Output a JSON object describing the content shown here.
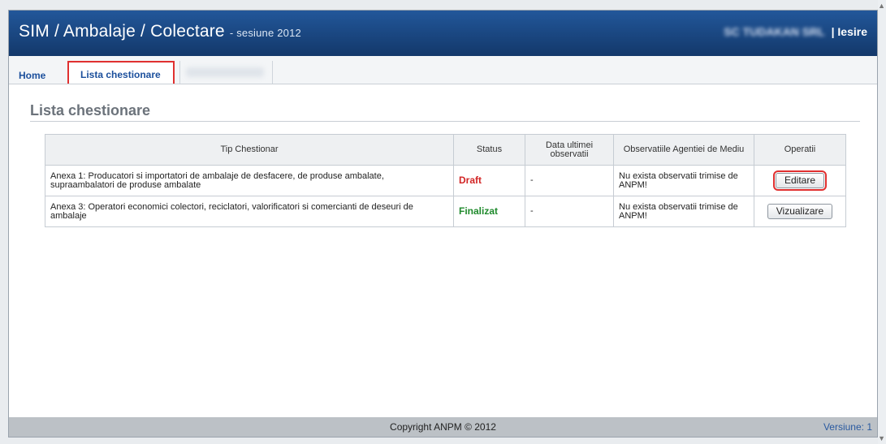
{
  "header": {
    "title": "SIM / Ambalaje / Colectare",
    "session": "- sesiune 2012",
    "company": "SC TUDAKAN SRL",
    "separator": "|",
    "logout": "Iesire"
  },
  "nav": {
    "home": "Home",
    "lista": "Lista chestionare"
  },
  "page": {
    "title": "Lista chestionare"
  },
  "table": {
    "headers": [
      "Tip Chestionar",
      "Status",
      "Data ultimei observatii",
      "Observatiile Agentiei de Mediu",
      "Operatii"
    ],
    "rows": [
      {
        "tip": "Anexa 1: Producatori si importatori de ambalaje de desfacere, de produse ambalate, supraambalatori de produse ambalate",
        "status": "Draft",
        "data": "-",
        "observatii": "Nu exista observatii trimise de ANPM!",
        "operatie": "Editare"
      },
      {
        "tip": "Anexa 3: Operatori economici colectori, reciclatori, valorificatori si comercianti de deseuri de ambalaje",
        "status": "Finalizat",
        "data": "-",
        "observatii": "Nu exista observatii trimise de ANPM!",
        "operatie": "Vizualizare"
      }
    ]
  },
  "footer": {
    "copyright": "Copyright ANPM © 2012",
    "version": "Versiune: 1"
  },
  "colors": {
    "header": "#1a4a8a",
    "draft": "#d22525",
    "finalizat": "#1f8a2c",
    "highlight": "#e03030"
  }
}
